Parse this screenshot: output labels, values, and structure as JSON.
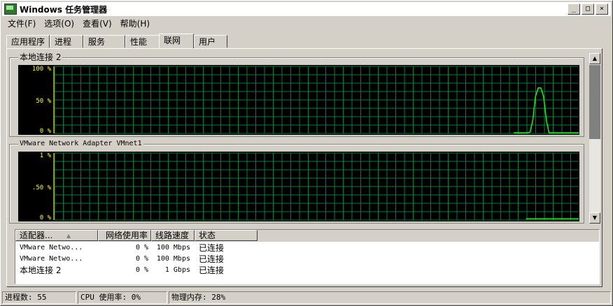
{
  "window": {
    "title": "Windows 任务管理器",
    "controls": {
      "minimize": "_",
      "maximize": "□",
      "close": "×"
    }
  },
  "menu": [
    "文件(F)",
    "选项(O)",
    "查看(V)",
    "帮助(H)"
  ],
  "tabs": [
    {
      "label": "应用程序",
      "active": false
    },
    {
      "label": "进程",
      "active": false
    },
    {
      "label": "服务",
      "active": false
    },
    {
      "label": "性能",
      "active": false
    },
    {
      "label": "联网",
      "active": true
    },
    {
      "label": "用户",
      "active": false
    }
  ],
  "graphs": [
    {
      "name": "本地连接 2",
      "y_ticks": [
        "100 %",
        "50 %",
        "0 %"
      ],
      "ylim": [
        0,
        100
      ],
      "line_color": "#00ff00",
      "grid_color": "#008040",
      "series": [
        0,
        0,
        0,
        0,
        0,
        0,
        0,
        0,
        0,
        0,
        0,
        0,
        0,
        0,
        0,
        0,
        0,
        0,
        0,
        0,
        0,
        0,
        0,
        0,
        0,
        0,
        0,
        0,
        0,
        0,
        0,
        0,
        0,
        0,
        0,
        0,
        0,
        0,
        0,
        0,
        0,
        0,
        0,
        0,
        0,
        0,
        0,
        0,
        0,
        0,
        0,
        0,
        0,
        0,
        0,
        0,
        0,
        0,
        0,
        0,
        0,
        0,
        0,
        0,
        0,
        0,
        0,
        0,
        0,
        0,
        0,
        0,
        0,
        0,
        0,
        0,
        0,
        0,
        0,
        0,
        0,
        0,
        0,
        0,
        0,
        0,
        0,
        0,
        0,
        0,
        0,
        0,
        0,
        0,
        0,
        0,
        0,
        0,
        0,
        0,
        0,
        0,
        0,
        0,
        0,
        0,
        0,
        0,
        0,
        0,
        0,
        0,
        0,
        0,
        0,
        0,
        0,
        0,
        0,
        0,
        0,
        0,
        0,
        0,
        0,
        0,
        0,
        0,
        0,
        0,
        0,
        0,
        0,
        0,
        0,
        0,
        0,
        0,
        0,
        0,
        0,
        0,
        0,
        0,
        0,
        0,
        0,
        0,
        0,
        0,
        0,
        0,
        0,
        0,
        0,
        0,
        0,
        0,
        0,
        0,
        0,
        0,
        0,
        0,
        0,
        0,
        0,
        0,
        0,
        0,
        1,
        1,
        1,
        1,
        1,
        1,
        2,
        20,
        55,
        68,
        68,
        55,
        20,
        1,
        1,
        1,
        1,
        1,
        1,
        1,
        1,
        1,
        1,
        1,
        1
      ]
    },
    {
      "name": "VMware Network Adapter VMnet1",
      "y_ticks": [
        "1 %",
        ".50 %",
        "0 %"
      ],
      "ylim": [
        0,
        1
      ],
      "line_color": "#00ff00",
      "grid_color": "#008040",
      "series": [
        0,
        0,
        0,
        0,
        0,
        0,
        0,
        0,
        0,
        0,
        0,
        0,
        0,
        0,
        0,
        0,
        0,
        0,
        0,
        0,
        0,
        0,
        0,
        0,
        0,
        0,
        0,
        0,
        0,
        0,
        0,
        0,
        0,
        0,
        0,
        0,
        0,
        0,
        0,
        0,
        0,
        0,
        0,
        0,
        0,
        0,
        0,
        0,
        0,
        0,
        0,
        0,
        0,
        0,
        0,
        0,
        0,
        0,
        0,
        0,
        0,
        0,
        0,
        0,
        0,
        0,
        0,
        0,
        0,
        0,
        0,
        0,
        0,
        0,
        0,
        0,
        0,
        0,
        0,
        0,
        0,
        0,
        0,
        0,
        0,
        0,
        0,
        0,
        0,
        0,
        0,
        0,
        0,
        0,
        0,
        0,
        0,
        0,
        0,
        0,
        0,
        0,
        0,
        0,
        0,
        0,
        0,
        0,
        0,
        0,
        0,
        0,
        0,
        0,
        0,
        0,
        0,
        0,
        0,
        0,
        0,
        0,
        0,
        0,
        0,
        0,
        0,
        0,
        0,
        0,
        0,
        0,
        0,
        0,
        0,
        0,
        0,
        0,
        0,
        0,
        0,
        0,
        0,
        0,
        0,
        0,
        0,
        0,
        0,
        0,
        0,
        0,
        0,
        0,
        0,
        0,
        0,
        0,
        0,
        0,
        0,
        0,
        0,
        0,
        0,
        0,
        0,
        0,
        0,
        0,
        0.02,
        0.02,
        0.02,
        0.02,
        0.02,
        0.02,
        0.02,
        0.02,
        0.02,
        0.02,
        0.02,
        0.02,
        0.02,
        0.02,
        0.02,
        0.02,
        0.02,
        0.02,
        0.02,
        0.02
      ]
    }
  ],
  "listview": {
    "columns": [
      "适配器...",
      "网络使用率",
      "线路速度",
      "状态"
    ],
    "sort_indicator": "▲",
    "rows": [
      {
        "adapter": "VMware Netwo...",
        "usage": "0 %",
        "speed": "100 Mbps",
        "status": "已连接"
      },
      {
        "adapter": "VMware Netwo...",
        "usage": "0 %",
        "speed": "100 Mbps",
        "status": "已连接"
      },
      {
        "adapter": "本地连接 2",
        "usage": "0 %",
        "speed": "1 Gbps",
        "status": "已连接"
      }
    ]
  },
  "statusbar": {
    "processes": "进程数: 55",
    "cpu": "CPU 使用率: 0%",
    "memory": "物理内存: 28%"
  }
}
